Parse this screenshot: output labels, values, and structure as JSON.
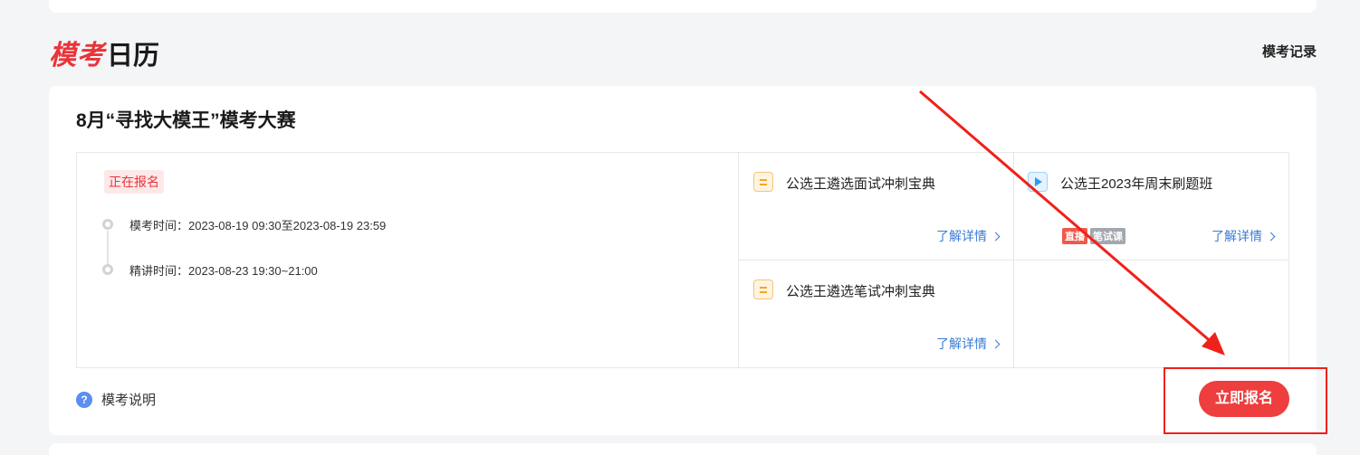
{
  "header": {
    "logo_red": "模考",
    "logo_black": "日历",
    "record_link": "模考记录"
  },
  "exam": {
    "title": "8月“寻找大模王”模考大赛",
    "status_badge": "正在报名",
    "timeline": [
      {
        "text": "模考时间：2023-08-19 09:30至2023-08-19 23:59"
      },
      {
        "text": "精讲时间：2023-08-23 19:30~21:00"
      }
    ],
    "courses": [
      {
        "name": "公选王遴选面试冲刺宝典",
        "more": "了解详情",
        "icon": "book-icon"
      },
      {
        "name": "公选王2023年周末刷题班",
        "more": "了解详情",
        "icon": "video-icon",
        "tags": [
          "直播",
          "笔试课"
        ]
      },
      {
        "name": "公选王遴选笔试冲刺宝典",
        "more": "了解详情",
        "icon": "book-icon"
      }
    ],
    "help_icon": "?",
    "help_text": "模考说明",
    "register_button": "立即报名"
  },
  "colors": {
    "accent_red": "#ee3e3e",
    "link_blue": "#3a7bd5",
    "annotation_red": "#f0201a"
  }
}
